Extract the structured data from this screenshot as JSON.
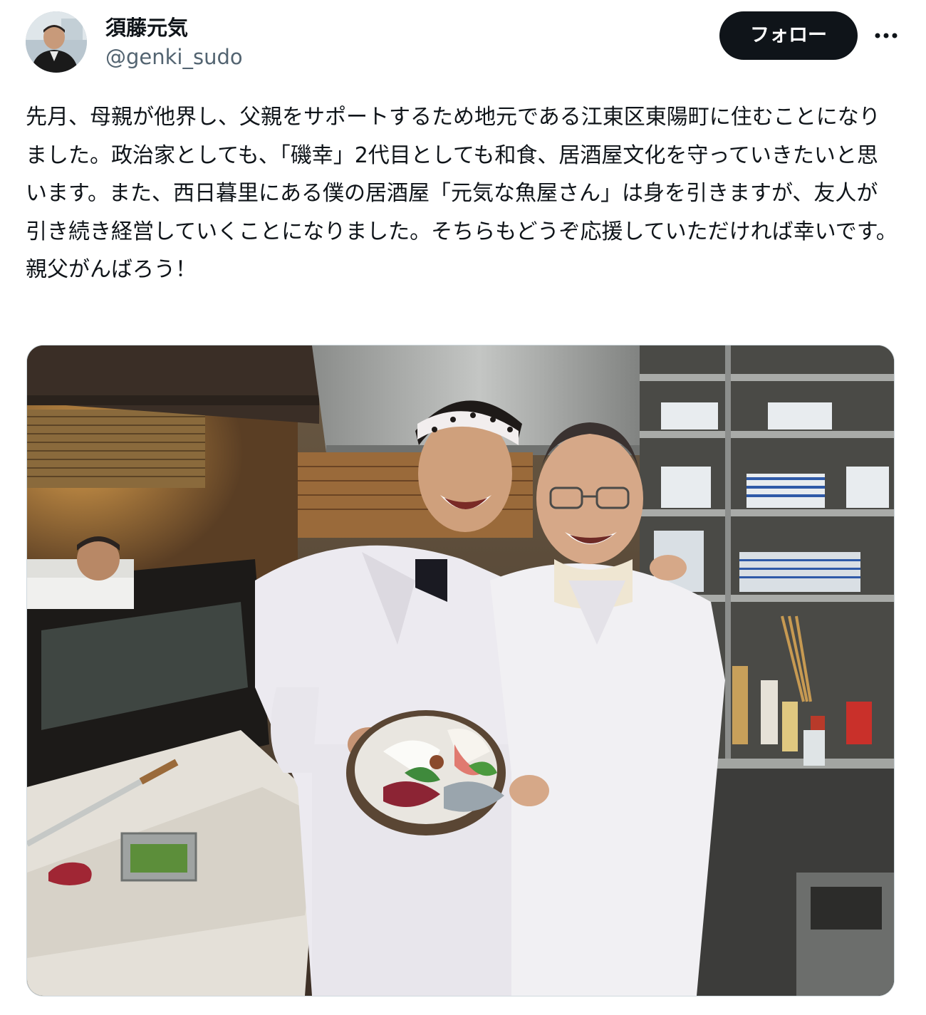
{
  "user": {
    "display_name": "須藤元気",
    "handle": "@genki_sudo"
  },
  "actions": {
    "follow_label": "フォロー",
    "more_icon": "more-horizontal-icon"
  },
  "tweet": {
    "text": "先月、母親が他界し、父親をサポートするため地元である江東区東陽町に住むことになりました。政治家としても、「磯幸」2代目としても和食、居酒屋文化を守っていきたいと思います。また、西日暮里にある僕の居酒屋「元気な魚屋さん」は身を引きますが、友人が引き続き経営していくことになりました。そちらもどうぞ応援していただければ幸いです。親父がんばろう！"
  },
  "media": {
    "type": "photo"
  }
}
